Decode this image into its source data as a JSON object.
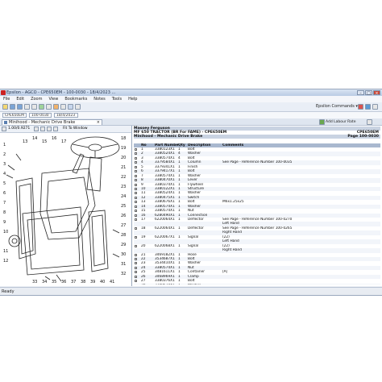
{
  "window": {
    "title": "Epsilon - AGCO - CPE650EM - 100-0030 - 18/4/2023 ...",
    "icon": "app-icon",
    "controls": [
      "–",
      "□",
      "×"
    ]
  },
  "menu": [
    "File",
    "Edit",
    "Zoom",
    "View",
    "Bookmarks",
    "Notes",
    "Tools",
    "Help"
  ],
  "toolbar": {
    "right_label": "Epsilon Commands ▾"
  },
  "pathbar": {
    "field1": "CPE650EM",
    "field2": "100-0030",
    "field3": "18/4/2023"
  },
  "tabs": [
    {
      "label": "Minihood - Mechanic Drive Brake",
      "close": "×"
    }
  ],
  "right_tools": {
    "add_labour_rate": "Add Labour Rate"
  },
  "image_toolbar": {
    "zoom_value": "1.00/0.9271",
    "fit_label": "Fit To Window"
  },
  "parts_header": {
    "brand": "Massey Ferguson",
    "model": "MF 650 TRACTOR (BR For FAME) - CPE650EM",
    "model_code": "CPE650EM",
    "section": "Minihood - Mechanic Drive Brake",
    "page": "Page 100-0030"
  },
  "columns": [
    "",
    "No",
    "Part Number",
    "Qty",
    "Description",
    "Comments"
  ],
  "rows": [
    {
      "no": "1",
      "part": "3380123X1",
      "qty": "1",
      "desc": "Bolt",
      "com": ""
    },
    {
      "no": "2",
      "part": "3380524X1",
      "qty": "4",
      "desc": "Washer",
      "com": ""
    },
    {
      "no": "3",
      "part": "3380574X1",
      "qty": "4",
      "desc": "Bolt",
      "com": ""
    },
    {
      "no": "4",
      "part": "3379584X1",
      "qty": "1",
      "desc": "Column",
      "com": "See Page - Reference Number 100-0035"
    },
    {
      "no": "5",
      "part": "3379341X1",
      "qty": "1",
      "desc": "Finish",
      "com": ""
    },
    {
      "no": "6",
      "part": "3379417X1",
      "qty": "1",
      "desc": "Bolt",
      "com": ""
    },
    {
      "no": "7",
      "part": "3380574X1",
      "qty": "1",
      "desc": "Washer",
      "com": ""
    },
    {
      "no": "8",
      "part": "3380470X1",
      "qty": "1",
      "desc": "Lever",
      "com": ""
    },
    {
      "no": "9",
      "part": "3380374X1",
      "qty": "1",
      "desc": "Flywheel",
      "com": ""
    },
    {
      "no": "10",
      "part": "3380122X1",
      "qty": "1",
      "desc": "Structure",
      "com": ""
    },
    {
      "no": "11",
      "part": "3380524X1",
      "qty": "1",
      "desc": "Washer",
      "com": ""
    },
    {
      "no": "12",
      "part": "3380475X1",
      "qty": "1",
      "desc": "Switch",
      "com": ""
    },
    {
      "no": "13",
      "part": "3380676X1",
      "qty": "1",
      "desc": "Bolt",
      "com": "M6x1.25x25"
    },
    {
      "no": "14",
      "part": "3380574X1",
      "qty": "1",
      "desc": "Washer",
      "com": ""
    },
    {
      "no": "15",
      "part": "3380574X1",
      "qty": "1",
      "desc": "Nut",
      "com": ""
    },
    {
      "no": "16",
      "part": "6280490X1",
      "qty": "1",
      "desc": "Connection",
      "com": ""
    },
    {
      "no": "17",
      "part": "6220064X1",
      "qty": "1",
      "desc": "Deflector",
      "com": "See Page - Reference Number 100-0270"
    },
    {
      "no": "",
      "part": "",
      "qty": "",
      "desc": "",
      "com": "Left Hand"
    },
    {
      "no": "18",
      "part": "6220064X1",
      "qty": "1",
      "desc": "Deflector",
      "com": "See Page - Reference Number 100-0265"
    },
    {
      "no": "",
      "part": "",
      "qty": "",
      "desc": "",
      "com": "Right Hand"
    },
    {
      "no": "19",
      "part": "6220067X1",
      "qty": "1",
      "desc": "Signal",
      "com": "(22)"
    },
    {
      "no": "",
      "part": "",
      "qty": "",
      "desc": "",
      "com": "Left Hand"
    },
    {
      "no": "20",
      "part": "6220068X1",
      "qty": "1",
      "desc": "Signal",
      "com": "(22)"
    },
    {
      "no": "",
      "part": "",
      "qty": "",
      "desc": "",
      "com": "Right Hand"
    },
    {
      "no": "21",
      "part": "3469182X1",
      "qty": "1",
      "desc": "Hose",
      "com": ""
    },
    {
      "no": "22",
      "part": "3534687X1",
      "qty": "1",
      "desc": "Bolt",
      "com": ""
    },
    {
      "no": "23",
      "part": "3534410X1",
      "qty": "1",
      "desc": "Washer",
      "com": ""
    },
    {
      "no": "24",
      "part": "3380574X1",
      "qty": "1",
      "desc": "Nut",
      "com": ""
    },
    {
      "no": "25",
      "part": "3481611X1",
      "qty": "1",
      "desc": "Container",
      "com": "[A]"
    },
    {
      "no": "26",
      "part": "3468969X1",
      "qty": "1",
      "desc": "Clamp",
      "com": ""
    },
    {
      "no": "27",
      "part": "3380376X1",
      "qty": "1",
      "desc": "Bolt",
      "com": ""
    },
    {
      "no": "28",
      "part": "3380524X1",
      "qty": "1",
      "desc": "Washer",
      "com": ""
    },
    {
      "no": "29",
      "part": "4178690X1",
      "qty": "1",
      "desc": "Valve",
      "com": ""
    }
  ],
  "diagram": {
    "callouts": [
      "1",
      "2",
      "3",
      "4",
      "5",
      "6",
      "7",
      "8",
      "9",
      "10",
      "11",
      "12",
      "13",
      "14",
      "15",
      "16",
      "17",
      "18",
      "19",
      "20",
      "21",
      "22",
      "23",
      "24",
      "25",
      "26",
      "27",
      "28",
      "29",
      "30",
      "31",
      "32",
      "33",
      "34",
      "35",
      "36",
      "37",
      "38",
      "39",
      "40",
      "41"
    ]
  },
  "status": {
    "text": "Ready"
  },
  "colors": {
    "accent": "#c9d3e2",
    "header_band": "#a9b8cf",
    "chrome": "#e9eef6"
  }
}
